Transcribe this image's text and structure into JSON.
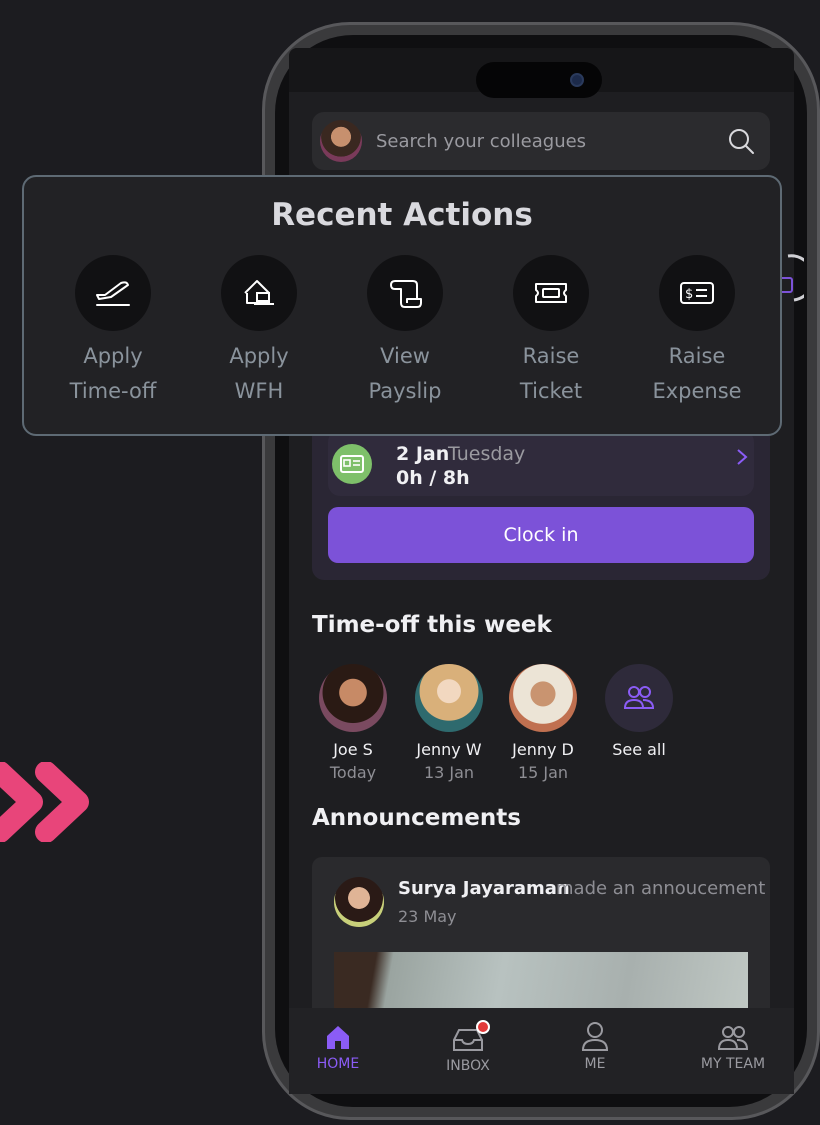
{
  "search": {
    "placeholder": "Search your colleagues"
  },
  "recent_actions": {
    "title": "Recent Actions",
    "items": [
      {
        "line1": "Apply",
        "line2": "Time-off",
        "icon": "airplane-icon"
      },
      {
        "line1": "Apply",
        "line2": "WFH",
        "icon": "home-laptop-icon"
      },
      {
        "line1": "View",
        "line2": "Payslip",
        "icon": "scroll-icon"
      },
      {
        "line1": "Raise",
        "line2": "Ticket",
        "icon": "ticket-icon"
      },
      {
        "line1": "Raise",
        "line2": "Expense",
        "icon": "expense-icon"
      }
    ]
  },
  "attendance": {
    "date": "2 Jan",
    "day": "Tuesday",
    "hours": "0h / 8h",
    "clock_in_label": "Clock in"
  },
  "timeoff": {
    "title": "Time-off this week",
    "people": [
      {
        "name": "Joe S",
        "date": "Today"
      },
      {
        "name": "Jenny W",
        "date": "13 Jan"
      },
      {
        "name": "Jenny D",
        "date": "15 Jan"
      }
    ],
    "see_all_label": "See all"
  },
  "announcements": {
    "title": "Announcements",
    "author": "Surya Jayaraman",
    "action": "made an annoucement",
    "date": "23 May"
  },
  "tabbar": {
    "tabs": [
      {
        "label": "HOME",
        "icon": "home-icon",
        "active": true
      },
      {
        "label": "INBOX",
        "icon": "inbox-icon",
        "active": false
      },
      {
        "label": "ME",
        "icon": "user-icon",
        "active": false
      },
      {
        "label": "MY TEAM",
        "icon": "team-icon",
        "active": false
      }
    ]
  },
  "colors": {
    "accent": "#7c52d8",
    "tab_active": "#8b5cf6",
    "chevrons": "#e8457a",
    "badge": "#e23a3a"
  }
}
